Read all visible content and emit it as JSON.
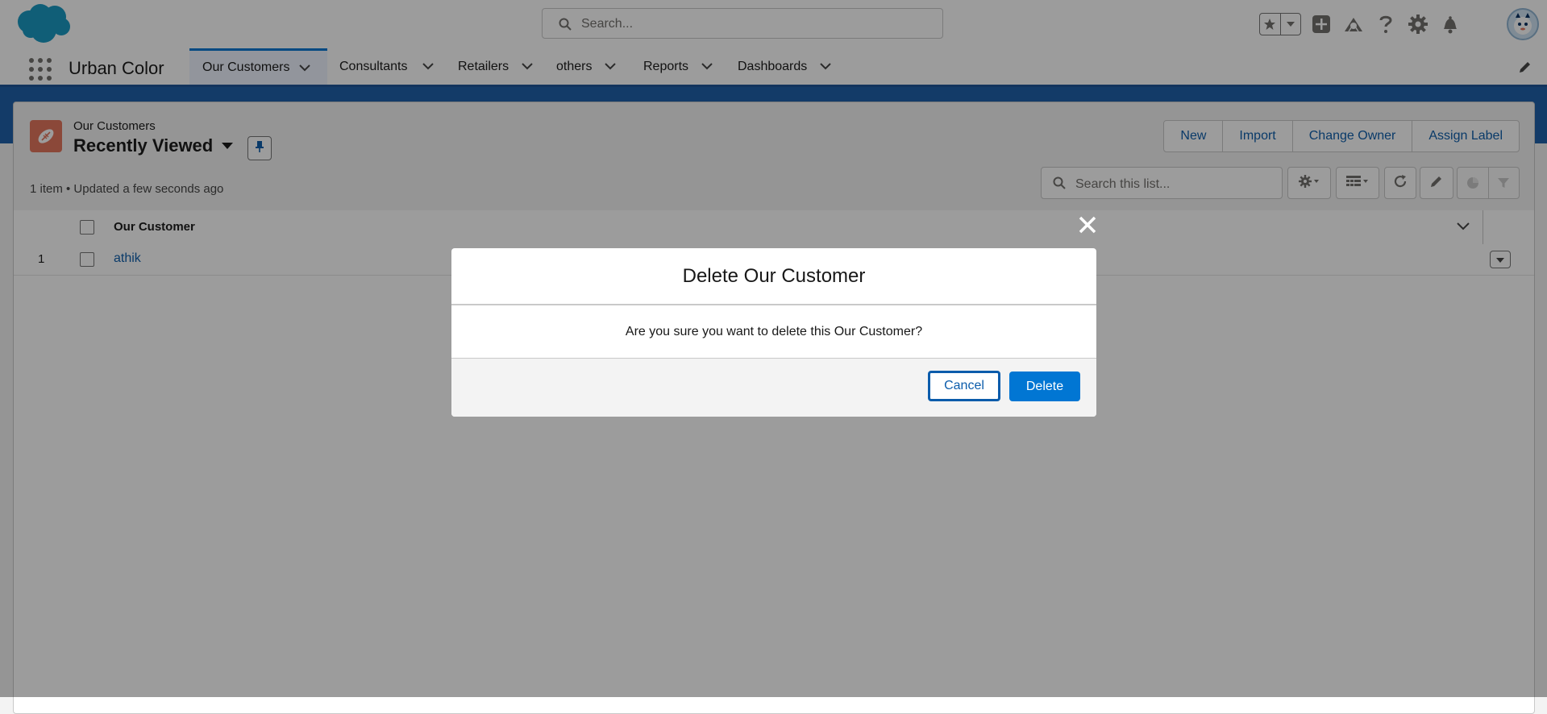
{
  "global_header": {
    "search_placeholder": "Search...",
    "icons": [
      "salesforce-cloud-logo",
      "favorites-star-icon",
      "favorites-dropdown-icon",
      "global-actions-plus-icon",
      "trailhead-icon",
      "help-icon",
      "setup-gear-icon",
      "notifications-bell-icon",
      "user-avatar"
    ]
  },
  "app_nav": {
    "app_name": "Urban Color",
    "tabs": [
      {
        "label": "Our Customers",
        "active": true
      },
      {
        "label": "Consultants",
        "active": false
      },
      {
        "label": "Retailers",
        "active": false
      },
      {
        "label": "others",
        "active": false
      },
      {
        "label": "Reports",
        "active": false
      },
      {
        "label": "Dashboards",
        "active": false
      }
    ]
  },
  "list_view": {
    "object_name": "Our Customers",
    "view_name": "Recently Viewed",
    "meta": "1 item • Updated a few seconds ago",
    "actions": [
      "New",
      "Import",
      "Change Owner",
      "Assign Label"
    ],
    "search_placeholder": "Search this list...",
    "column_header": "Our Customer",
    "rows": [
      {
        "num": "1",
        "name": "athik"
      }
    ]
  },
  "modal": {
    "title": "Delete Our Customer",
    "message": "Are you sure you want to delete this Our Customer?",
    "cancel_label": "Cancel",
    "delete_label": "Delete"
  },
  "colors": {
    "brand_blue": "#0176d3",
    "link_blue": "#0b5cab",
    "object_icon": "#e3735b",
    "nav_band": "#1b5ea8"
  }
}
